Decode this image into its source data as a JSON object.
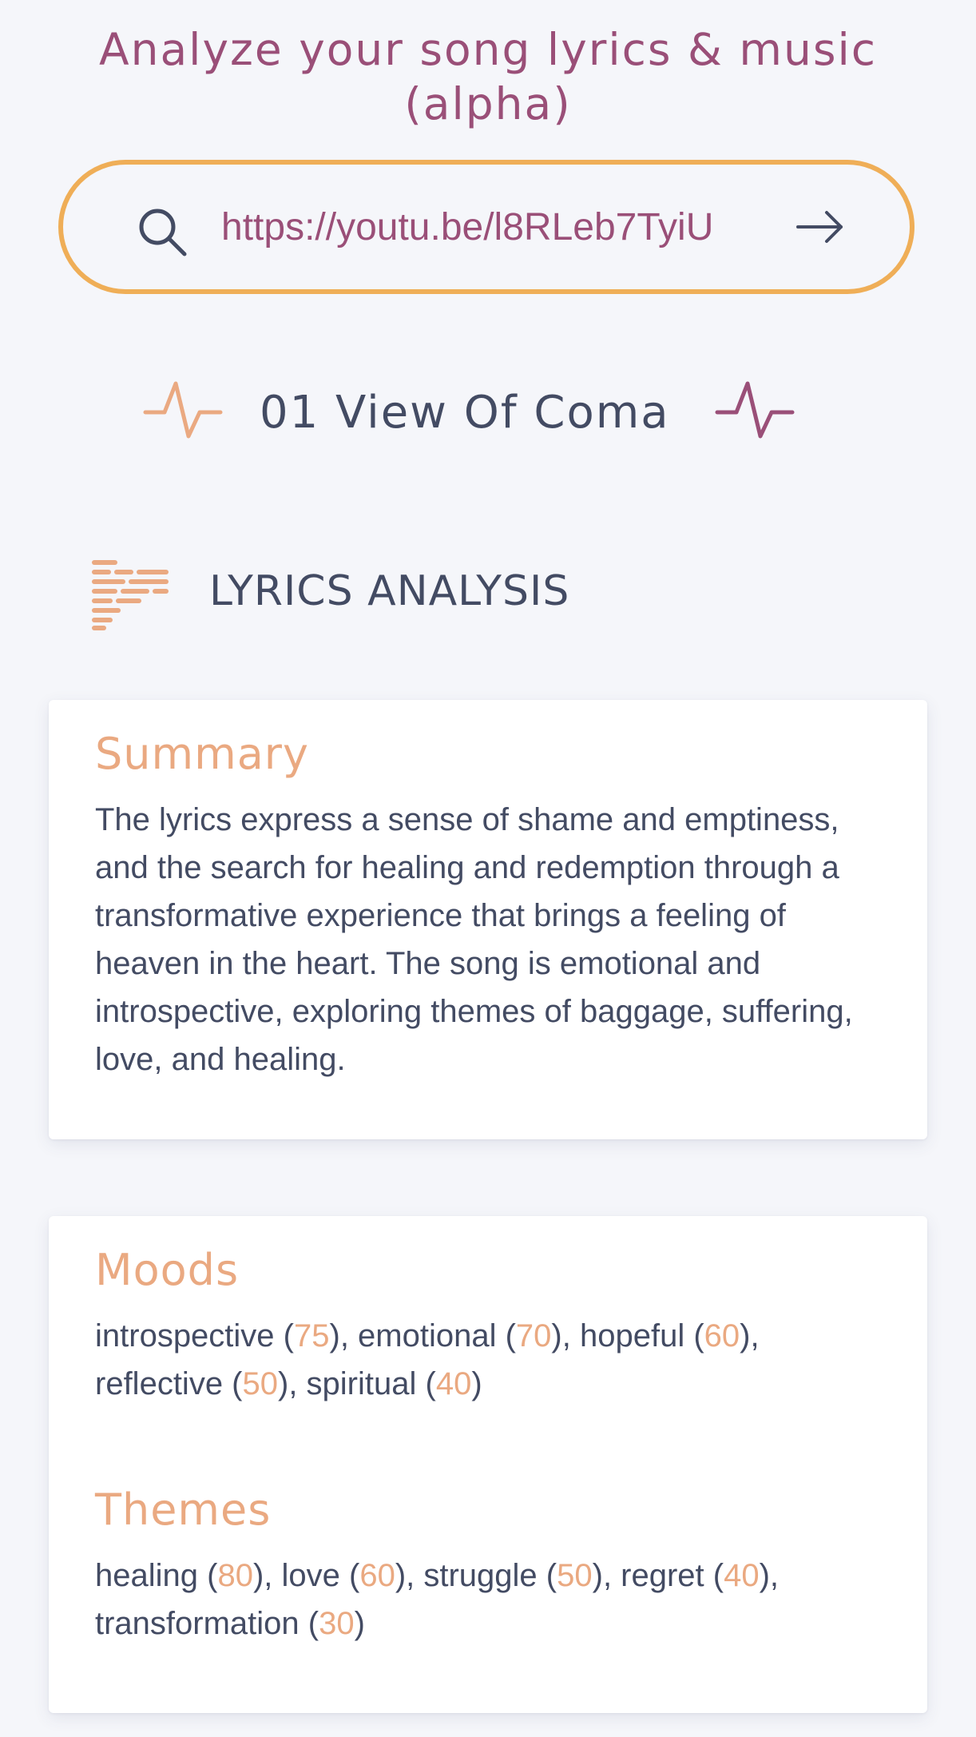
{
  "page": {
    "title": "Analyze your song lyrics & music (alpha)"
  },
  "search": {
    "value": "https://youtu.be/l8RLeb7TyiU",
    "icon": "search-icon",
    "submit_icon": "arrow-right-icon"
  },
  "song": {
    "title": "01 View Of Coma",
    "left_icon": "pulse-icon",
    "right_icon": "pulse-icon"
  },
  "lyrics_section": {
    "title": "LYRICS ANALYSIS",
    "icon": "lyrics-lines-icon"
  },
  "summary": {
    "heading": "Summary",
    "text": "The lyrics express a sense of shame and emptiness, and the search for healing and redemption through a transformative experience that brings a feeling of heaven in the heart. The song is emotional and introspective, exploring themes of baggage, suffering, love, and healing."
  },
  "moods": {
    "heading": "Moods",
    "items": [
      {
        "name": "introspective",
        "score": "75"
      },
      {
        "name": "emotional",
        "score": "70"
      },
      {
        "name": "hopeful",
        "score": "60"
      },
      {
        "name": "reflective",
        "score": "50"
      },
      {
        "name": "spiritual",
        "score": "40"
      }
    ]
  },
  "themes": {
    "heading": "Themes",
    "items": [
      {
        "name": "healing",
        "score": "80"
      },
      {
        "name": "love",
        "score": "60"
      },
      {
        "name": "struggle",
        "score": "50"
      },
      {
        "name": "regret",
        "score": "40"
      },
      {
        "name": "transformation",
        "score": "30"
      }
    ]
  },
  "colors": {
    "background": "#f5f6fa",
    "title_plum": "#9a4f78",
    "accent_orange": "#efae57",
    "peach": "#eaa981",
    "text_dark": "#434b63"
  }
}
